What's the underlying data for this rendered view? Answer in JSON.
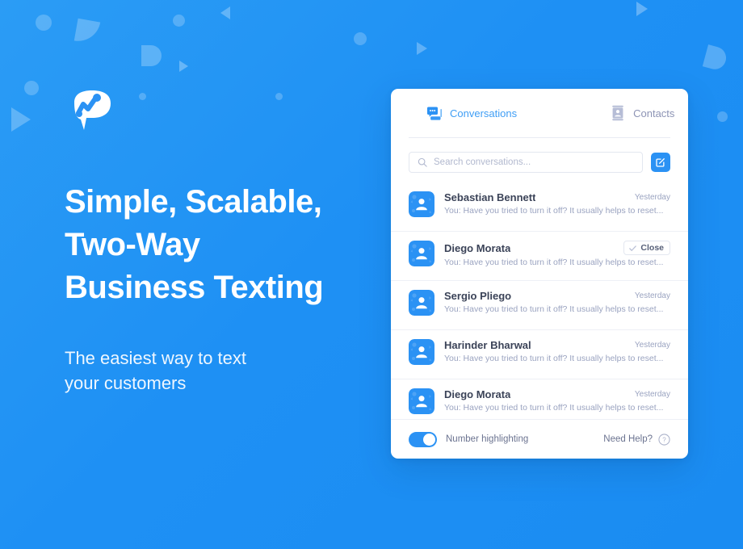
{
  "brand": {
    "accent": "#2b92f4",
    "background": "#2196f3",
    "logo_icon": "speech-bubble-zigzag-logo"
  },
  "hero": {
    "headline": "Simple, Scalable,\nTwo-Way\nBusiness Texting",
    "subheadline": "The easiest way to text\nyour customers"
  },
  "card": {
    "tabs": [
      {
        "label": "Conversations",
        "icon": "chat-bubbles-icon",
        "active": true
      },
      {
        "label": "Contacts",
        "icon": "contact-card-icon",
        "active": false
      }
    ],
    "search": {
      "placeholder": "Search conversations...",
      "value": "",
      "icon": "search-icon"
    },
    "compose": {
      "icon": "compose-pencil-icon",
      "label": "New conversation"
    },
    "conversations": [
      {
        "name": "Sebastian Bennett",
        "preview": "You: Have you tried to turn it off? It usually helps to reset...",
        "time": "Yesterday",
        "avatar_icon": "person-avatar-icon",
        "has_close": false
      },
      {
        "name": "Diego Morata",
        "preview": "You: Have you tried to turn it off? It usually helps to reset...",
        "time": "",
        "avatar_icon": "person-avatar-icon",
        "has_close": true,
        "close_label": "Close",
        "close_icon": "check-icon"
      },
      {
        "name": "Sergio Pliego",
        "preview": "You: Have you tried to turn it off? It usually helps to reset...",
        "time": "Yesterday",
        "avatar_icon": "person-avatar-icon",
        "has_close": false
      },
      {
        "name": "Harinder Bharwal",
        "preview": "You: Have you tried to turn it off? It usually helps to reset...",
        "time": "Yesterday",
        "avatar_icon": "person-avatar-icon",
        "has_close": false
      },
      {
        "name": "Diego Morata",
        "preview": "You: Have you tried to turn it off? It usually helps to reset...",
        "time": "Yesterday",
        "avatar_icon": "person-avatar-icon",
        "has_close": false
      }
    ],
    "footer": {
      "toggle_label": "Number highlighting",
      "toggle_on": true,
      "help_label": "Need Help?",
      "help_icon": "question-mark-circle-icon"
    }
  }
}
